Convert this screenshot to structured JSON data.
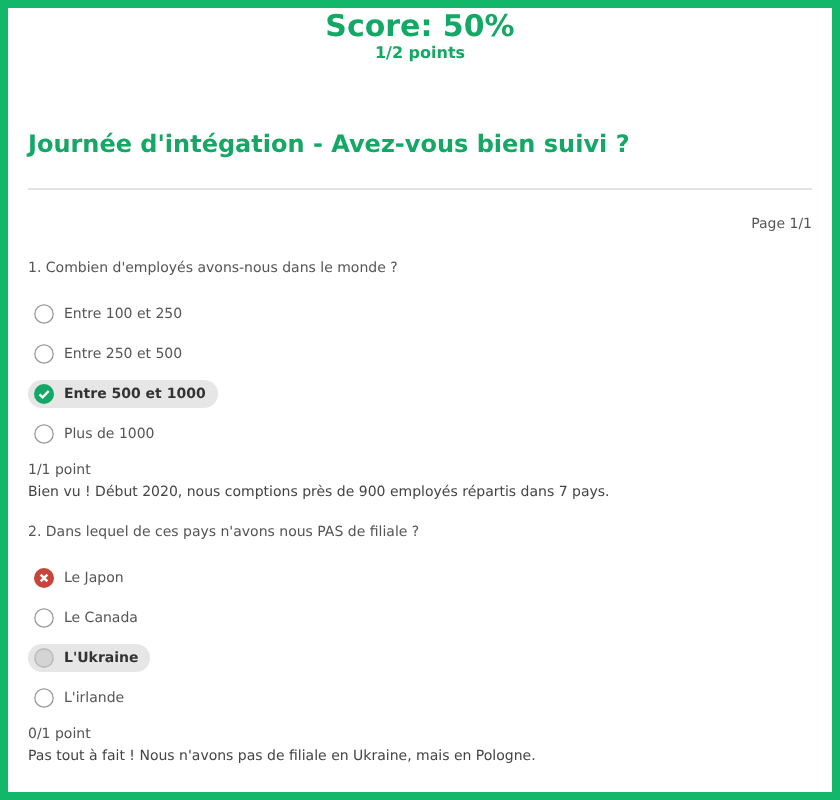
{
  "score": {
    "title": "Score: 50%",
    "points": "1/2 points"
  },
  "quiz_title": "Journée d'intégation - Avez-vous bien suivi ?",
  "page_label": "Page 1/1",
  "questions": [
    {
      "question": "1. Combien d'employés avons-nous dans le monde ?",
      "options": [
        {
          "label": "Entre 100 et 250",
          "selected": false,
          "correct": false
        },
        {
          "label": "Entre 250 et 500",
          "selected": false,
          "correct": false
        },
        {
          "label": "Entre 500 et 1000",
          "selected": true,
          "correct": true
        },
        {
          "label": "Plus de 1000",
          "selected": false,
          "correct": false
        }
      ],
      "points": "1/1 point",
      "feedback": "Bien vu ! Début 2020, nous comptions près de 900 employés répartis dans 7 pays."
    },
    {
      "question": "2. Dans lequel de ces pays n'avons nous PAS de filiale ?",
      "options": [
        {
          "label": "Le Japon",
          "selected": true,
          "correct": false
        },
        {
          "label": "Le Canada",
          "selected": false,
          "correct": false
        },
        {
          "label": "L'Ukraine",
          "selected": false,
          "correct": true
        },
        {
          "label": "L'irlande",
          "selected": false,
          "correct": false
        }
      ],
      "points": "0/1 point",
      "feedback": "Pas tout à fait ! Nous n'avons pas de filiale en Ukraine, mais en Pologne."
    }
  ]
}
